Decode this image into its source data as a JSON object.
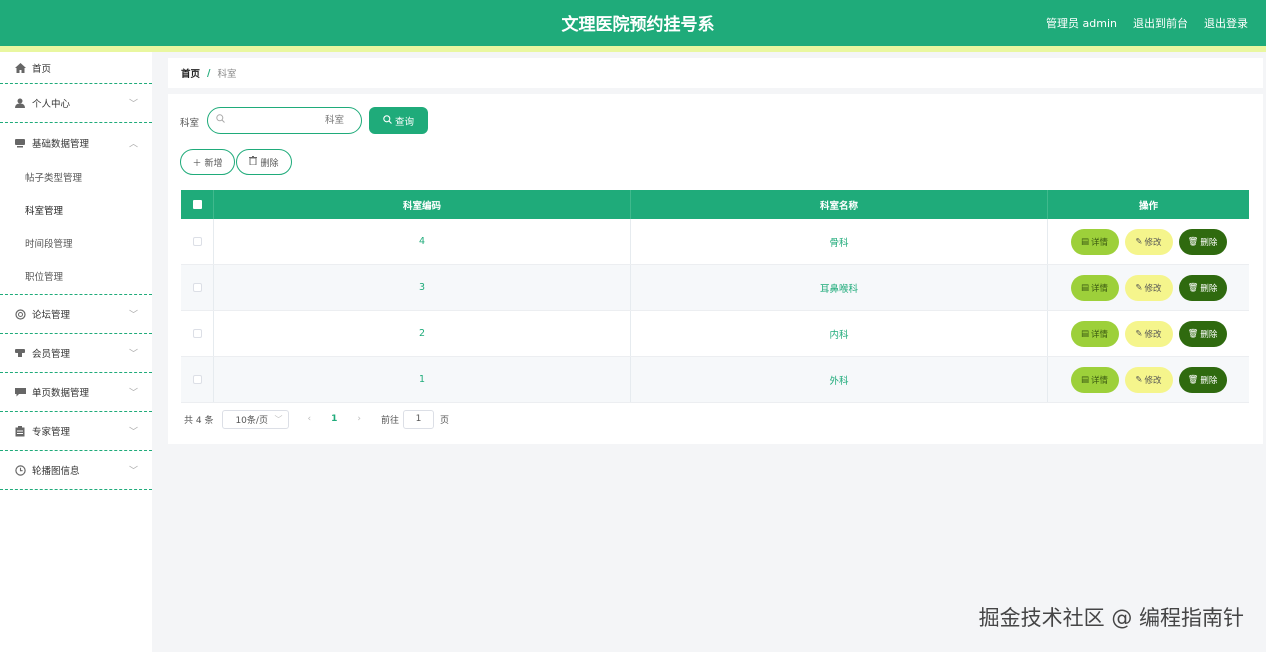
{
  "header": {
    "title": "文理医院预约挂号系",
    "admin_label": "管理员 admin",
    "to_front_label": "退出到前台",
    "logout_label": "退出登录"
  },
  "sidebar": {
    "home": "首页",
    "personal_center": "个人中心",
    "basic_data": "基础数据管理",
    "basic_children": [
      "帖子类型管理",
      "科室管理",
      "时间段管理",
      "职位管理"
    ],
    "forum": "论坛管理",
    "member": "会员管理",
    "single_page": "单页数据管理",
    "expert": "专家管理",
    "carousel": "轮播图信息"
  },
  "breadcrumb": {
    "home": "首页",
    "separator": "/",
    "current": "科室"
  },
  "search": {
    "label": "科室",
    "placeholder": "科室",
    "query_button": "查询"
  },
  "toolbar": {
    "add_label": "新增",
    "delete_label": "删除"
  },
  "table": {
    "columns": [
      "科室编码",
      "科室名称",
      "操作"
    ],
    "rows": [
      {
        "code": "4",
        "name": "骨科"
      },
      {
        "code": "3",
        "name": "耳鼻喉科"
      },
      {
        "code": "2",
        "name": "内科"
      },
      {
        "code": "1",
        "name": "外科"
      }
    ],
    "actions": {
      "detail": "详情",
      "edit": "修改",
      "delete": "删除"
    }
  },
  "pagination": {
    "total_text": "共 4 条",
    "page_size": "10条/页",
    "current_page": "1",
    "goto_label": "前往",
    "goto_value": "1",
    "goto_unit": "页"
  },
  "watermark": "掘金技术社区 @ 编程指南针",
  "colors": {
    "primary": "#1fab7a",
    "stripe": "#e9f7a0",
    "detail": "#9dd03a",
    "edit": "#f5f58c",
    "delete": "#2f6a0f"
  }
}
